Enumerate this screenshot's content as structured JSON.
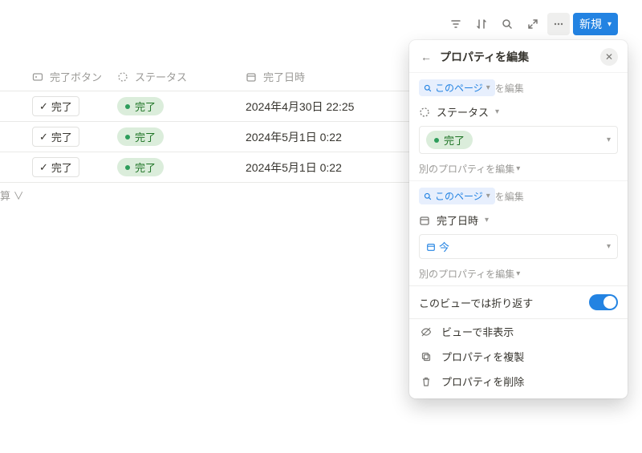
{
  "toolbar": {
    "new_label": "新規"
  },
  "columns": {
    "button": "完了ボタン",
    "status": "ステータス",
    "date": "完了日時"
  },
  "rows": [
    {
      "button": "完了",
      "status": "完了",
      "date": "2024年4月30日 22:25"
    },
    {
      "button": "完了",
      "status": "完了",
      "date": "2024年5月1日 0:22"
    },
    {
      "button": "完了",
      "status": "完了",
      "date": "2024年5月1日 0:22"
    }
  ],
  "summary": "算 ∨",
  "panel": {
    "title": "プロパティを編集",
    "this_page": "このページ",
    "edit_suffix": "を編集",
    "status_label": "ステータス",
    "status_value": "完了",
    "date_label": "完了日時",
    "date_value": "今",
    "edit_other": "別のプロパティを編集",
    "wrap_label": "このビューでは折り返す",
    "hide": "ビューで非表示",
    "duplicate": "プロパティを複製",
    "delete": "プロパティを削除"
  }
}
